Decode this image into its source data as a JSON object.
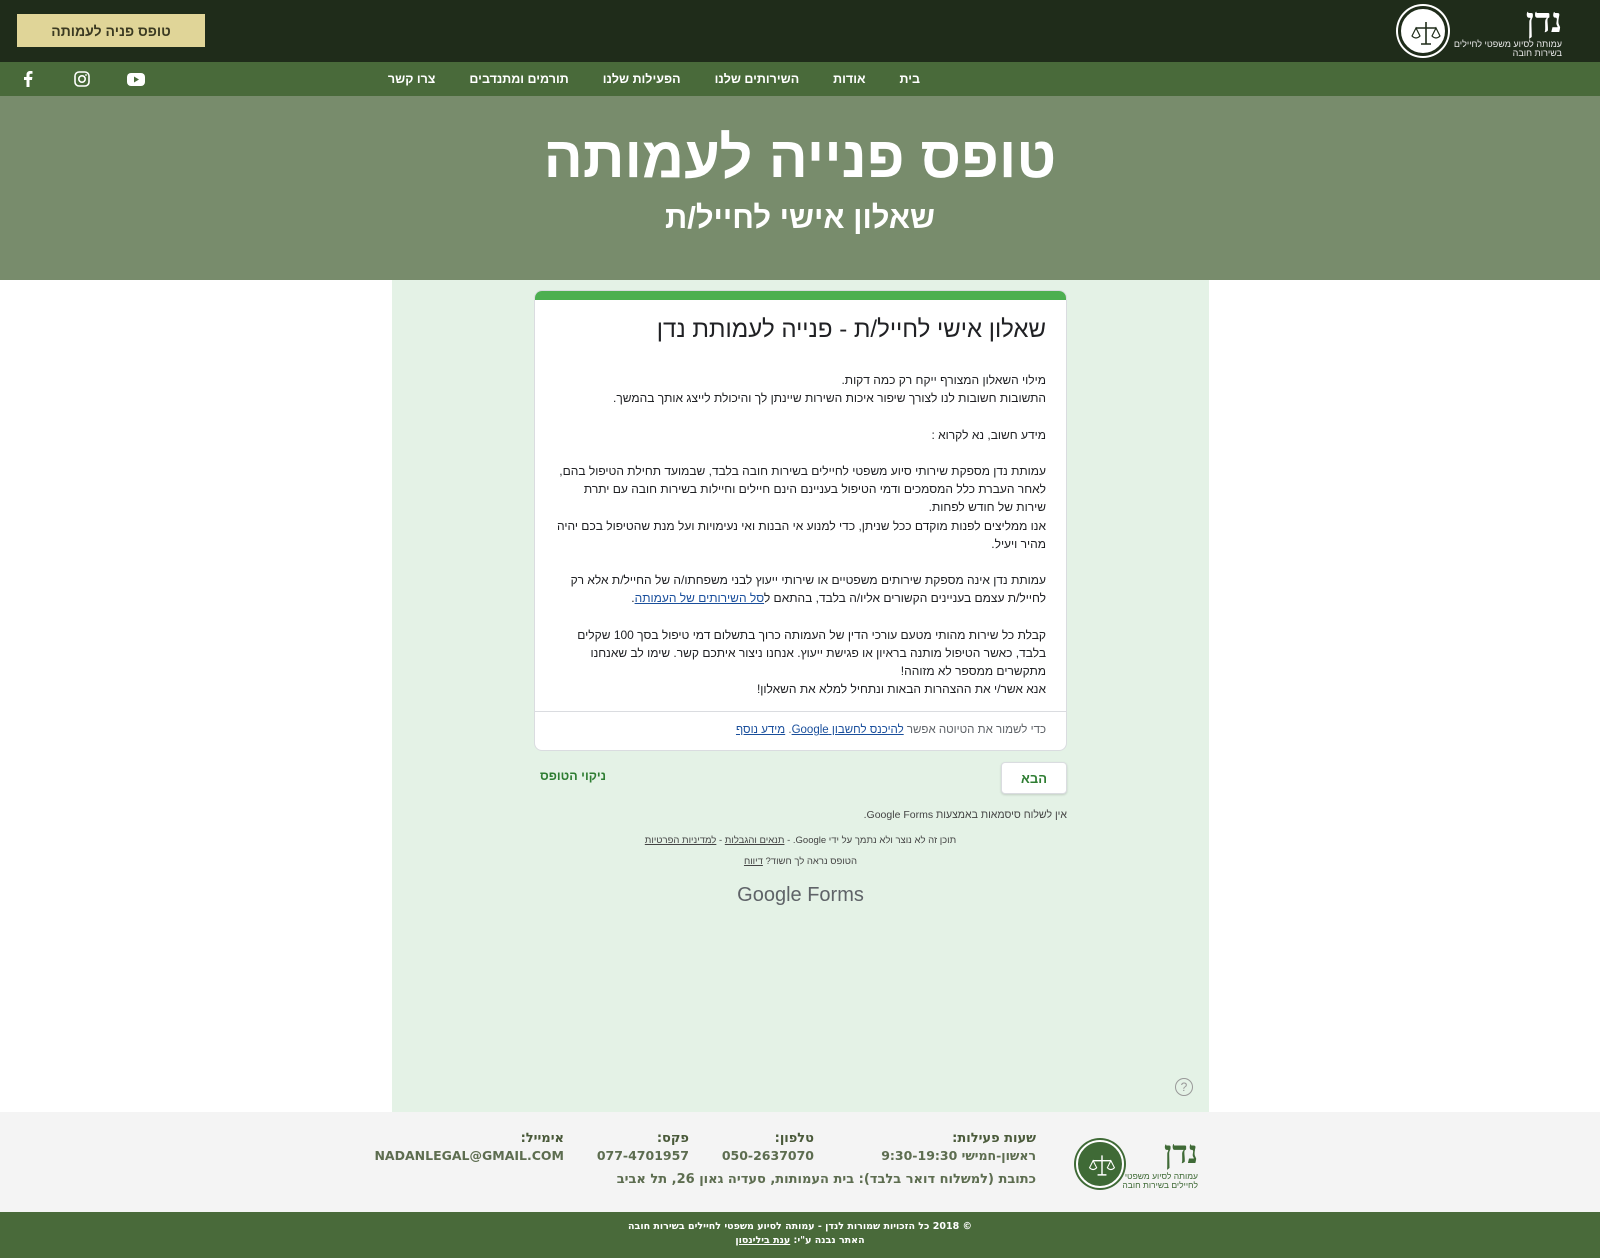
{
  "header": {
    "cta_label": "טופס פניה לעמותה",
    "logo_name": "נדן",
    "logo_subtitle": "עמותה לסיוע משפטי לחיילים בשירות חובה"
  },
  "nav": {
    "items": [
      "בית",
      "אודות",
      "השירותים שלנו",
      "הפעילות שלנו",
      "תורמים ומתנדבים",
      "צרו קשר"
    ]
  },
  "social": [
    "youtube-icon",
    "instagram-icon",
    "facebook-icon"
  ],
  "hero": {
    "title": "טופס פנייה לעמותה",
    "subtitle": "שאלון אישי לחייל/ת"
  },
  "form": {
    "title": "שאלון אישי לחייל/ת - פנייה לעמותת נדן",
    "p1": "מילוי השאלון המצורף ייקח רק כמה דקות.\nהתשובות חשובות לנו לצורך שיפור איכות השירות שיינתן לך והיכולת לייצג אותך בהמשך.",
    "p2": "מידע חשוב, נא לקרוא :",
    "p3": "עמותת נדן מספקת שירותי סיוע משפטי לחיילים בשירות חובה בלבד, שבמועד תחילת הטיפול בהם, לאחר העברת כלל המסמכים ודמי הטיפול בעניינם הינם חיילים וחיילות בשירות חובה עם יתרת שירות של חודש לפחות.\nאנו ממליצים לפנות מוקדם ככל שניתן, כדי למנוע אי הבנות ואי נעימויות ועל מנת שהטיפול בכם יהיה מהיר ויעיל.",
    "p4_a": "עמותת נדן אינה מספקת שירותים משפטיים או שירותי ייעוץ לבני משפחתו/ה של החייל/ת אלא רק לחייל/ת עצמם בעניינים הקשורים אליו/ה בלבד, בהתאם ל",
    "p4_link": "סל השירותים של העמותה",
    "p4_b": ".",
    "p5": "קבלת כל שירות מהותי מטעם עורכי הדין של העמותה כרוך בתשלום דמי טיפול בסך 100 שקלים בלבד, כאשר הטיפול מותנה בראיון או פגישת ייעוץ. אנחנו ניצור איתכם קשר. שימו לב שאנחנו מתקשרים ממספר לא מזוהה!\nאנא אשר/י את ההצהרות הבאות ונתחיל למלא את השאלון!",
    "save_text": "כדי לשמור את הטיוטה אפשר ",
    "save_link": "להיכנס לחשבון Google",
    "more_info": "מידע נוסף",
    "next_label": "הבא",
    "clear_label": "ניקוי הטופס",
    "no_passwords": "אין לשלוח סיסמאות באמצעות Google Forms.",
    "disclaimer": "תוכן זה לא נוצר ולא נתמך על ידי Google. - ",
    "terms": "תנאים והגבלות",
    "privacy": "למדיניות הפרטיות",
    "suspicious": "הטופס נראה לך חשוד? ",
    "report": "דיווח",
    "brand_a": "Google",
    "brand_b": " Forms"
  },
  "footer": {
    "hours_label": "שעות פעילות:",
    "hours_value": "ראשון-חמישי 9:30-19:30",
    "phone_label": "טלפון:",
    "phone_value": "050-2637070",
    "fax_label": "פקס:",
    "fax_value": "077-4701957",
    "email_label": "אימייל:",
    "email_value": "NADANLEGAL@GMAIL.COM",
    "address": "כתובת (למשלוח דואר בלבד): בית העמותות, סעדיה גאון 26, תל אביב",
    "copyright": "© 2018 כל הזכויות שמורות לנדן - עמותה לסיוע משפטי לחיילים בשירות חובה",
    "built_by": "האתר נבנה ע\"י: ",
    "builder": "ענת בילינסון"
  }
}
